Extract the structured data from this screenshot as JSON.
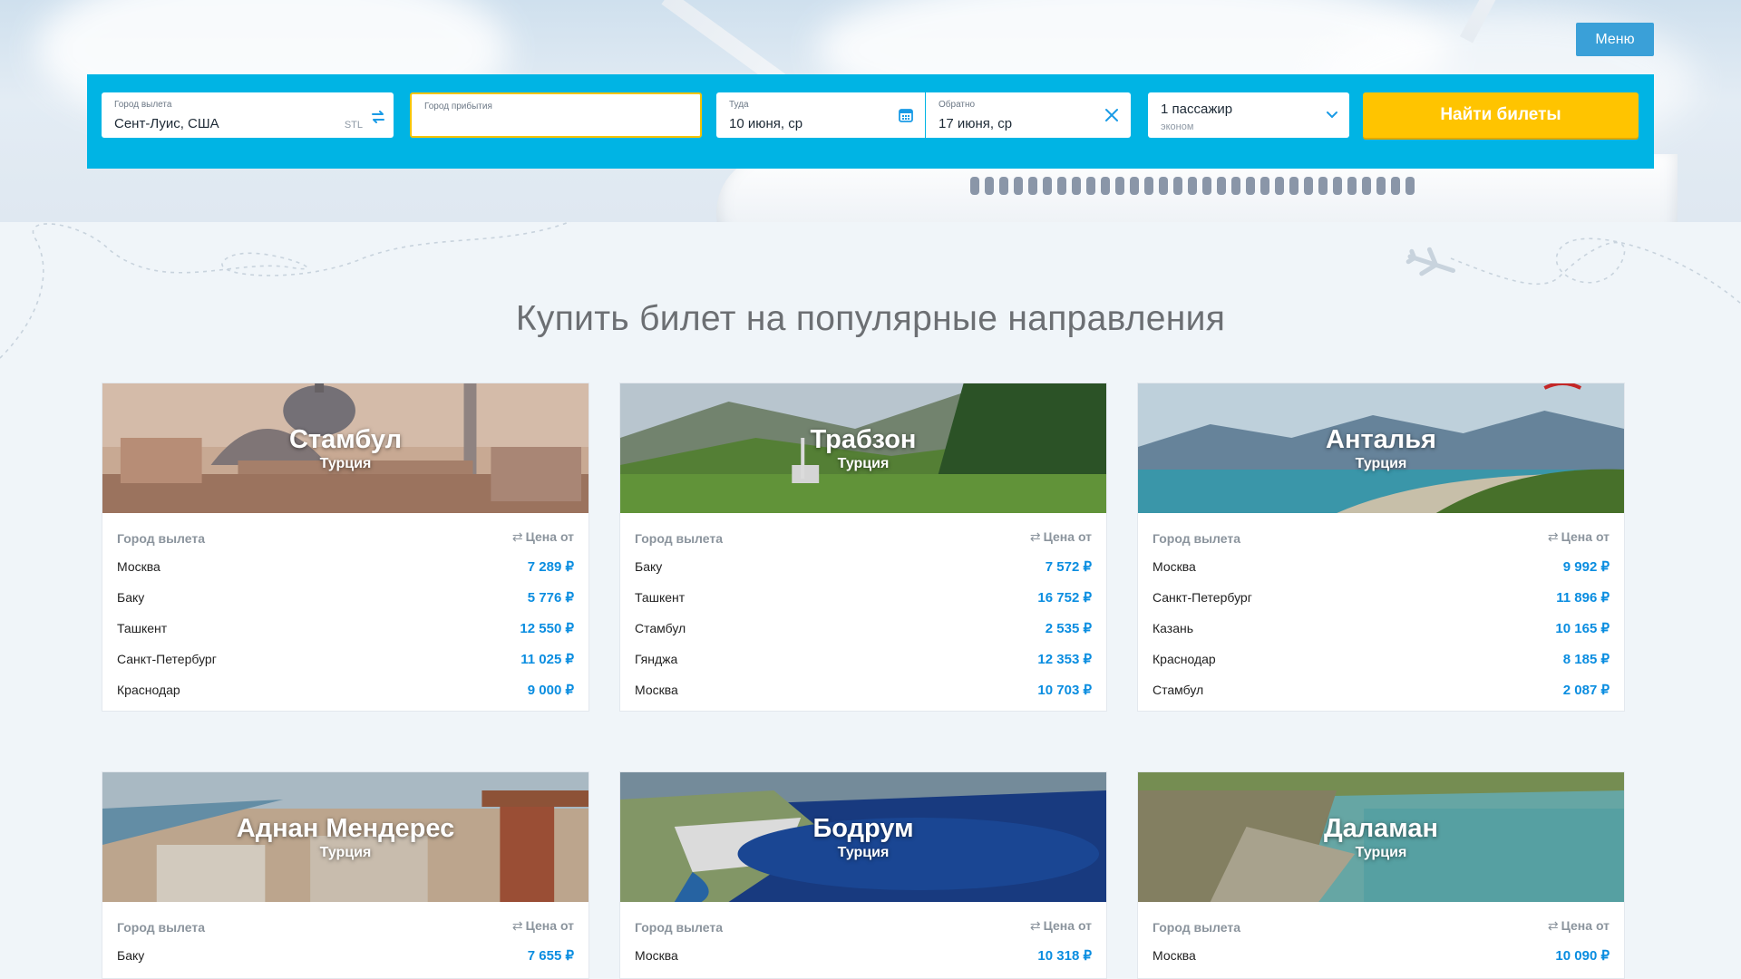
{
  "header": {
    "menu_label": "Меню"
  },
  "search": {
    "from": {
      "label": "Город вылета",
      "value": "Сент-Луис, США",
      "code": "STL"
    },
    "to": {
      "label": "Город прибытия",
      "value": ""
    },
    "there": {
      "label": "Туда",
      "value": "10 июня, ср"
    },
    "back": {
      "label": "Обратно",
      "value": "17 июня, ср"
    },
    "passengers": {
      "value": "1 пассажир",
      "class": "эконом"
    },
    "submit_label": "Найти билеты"
  },
  "section_title": "Купить билет на популярные направления",
  "labels": {
    "from_city": "Город вылета",
    "price_from": "Цена от",
    "currency": "₽"
  },
  "cards": [
    {
      "city": "Стамбул",
      "country": "Турция",
      "rows": [
        {
          "city": "Москва",
          "price": "7 289 ₽"
        },
        {
          "city": "Баку",
          "price": "5 776 ₽"
        },
        {
          "city": "Ташкент",
          "price": "12 550 ₽"
        },
        {
          "city": "Санкт-Петербург",
          "price": "11 025 ₽"
        },
        {
          "city": "Краснодар",
          "price": "9 000 ₽"
        }
      ]
    },
    {
      "city": "Трабзон",
      "country": "Турция",
      "rows": [
        {
          "city": "Баку",
          "price": "7 572 ₽"
        },
        {
          "city": "Ташкент",
          "price": "16 752 ₽"
        },
        {
          "city": "Стамбул",
          "price": "2 535 ₽"
        },
        {
          "city": "Гянджа",
          "price": "12 353 ₽"
        },
        {
          "city": "Москва",
          "price": "10 703 ₽"
        }
      ]
    },
    {
      "city": "Анталья",
      "country": "Турция",
      "rows": [
        {
          "city": "Москва",
          "price": "9 992 ₽"
        },
        {
          "city": "Санкт-Петербург",
          "price": "11 896 ₽"
        },
        {
          "city": "Казань",
          "price": "10 165 ₽"
        },
        {
          "city": "Краснодар",
          "price": "8 185 ₽"
        },
        {
          "city": "Стамбул",
          "price": "2 087 ₽"
        }
      ]
    },
    {
      "city": "Аднан Мендерес",
      "country": "Турция",
      "rows": [
        {
          "city": "Баку",
          "price": "7 655 ₽"
        }
      ]
    },
    {
      "city": "Бодрум",
      "country": "Турция",
      "rows": [
        {
          "city": "Москва",
          "price": "10 318 ₽"
        }
      ]
    },
    {
      "city": "Даламан",
      "country": "Турция",
      "rows": [
        {
          "city": "Москва",
          "price": "10 090 ₽"
        }
      ]
    }
  ],
  "colors": {
    "accent": "#00b4e4",
    "button": "#ffc400",
    "price": "#0a8de0"
  },
  "icons": {
    "swap": "swap-arrows-icon",
    "calendar": "calendar-icon",
    "clear": "close-icon",
    "dropdown": "chevron-down-icon",
    "roundtrip": "roundtrip-arrows-icon"
  }
}
